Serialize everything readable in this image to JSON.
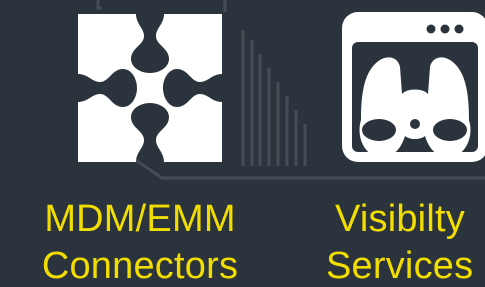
{
  "colors": {
    "background": "#2b333c",
    "icon": "#ffffff",
    "label": "#f2dd00"
  },
  "features": [
    {
      "icon": "puzzle-connector-icon",
      "line1": "MDM/EMM",
      "line2": "Connectors"
    },
    {
      "icon": "binoculars-window-icon",
      "line1": "Visibilty",
      "line2": "Services"
    }
  ]
}
